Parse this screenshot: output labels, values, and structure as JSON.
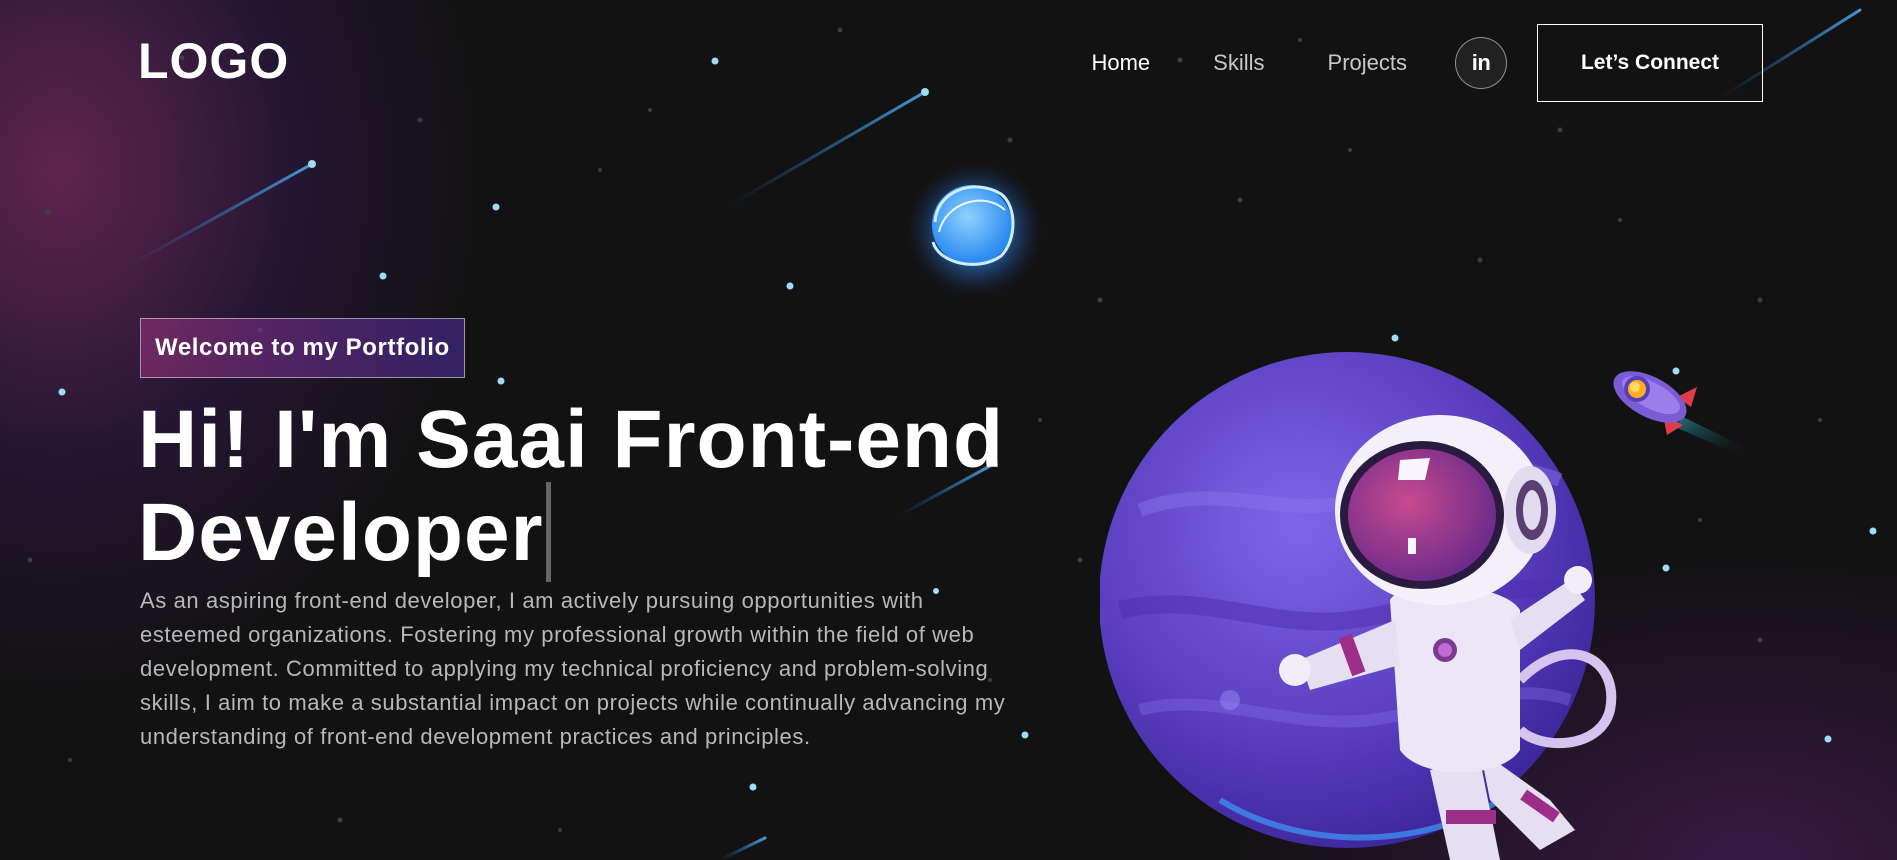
{
  "nav": {
    "logo": "LOGO",
    "links": [
      {
        "label": "Home",
        "active": true
      },
      {
        "label": "Skills",
        "active": false
      },
      {
        "label": "Projects",
        "active": false
      }
    ],
    "social_icon": "linkedin-icon",
    "social_label": "in",
    "connect_label": "Let’s Connect"
  },
  "hero": {
    "tagline": "Welcome to my Portfolio",
    "headline_line1": "Hi! I'm Saai Front-end",
    "headline_line2": "Developer",
    "bio": "As an aspiring front-end developer, I am actively pursuing opportunities with esteemed organizations. Fostering my professional growth within the field of web development. Committed to applying my technical proficiency and problem-solving skills, I aim to make a substantial impact on projects while continually advancing my understanding of front-end development practices and principles."
  },
  "colors": {
    "background": "#121212",
    "accent_pink": "#AA367C",
    "accent_purple": "#4A2FBD",
    "planet": "#5b3fc4",
    "orb": "#4aa8ff"
  },
  "illustration": {
    "planet": "planet-illustration",
    "astronaut": "astronaut-illustration",
    "orb": "glowing-orb-illustration",
    "rocket": "rocket-illustration"
  }
}
